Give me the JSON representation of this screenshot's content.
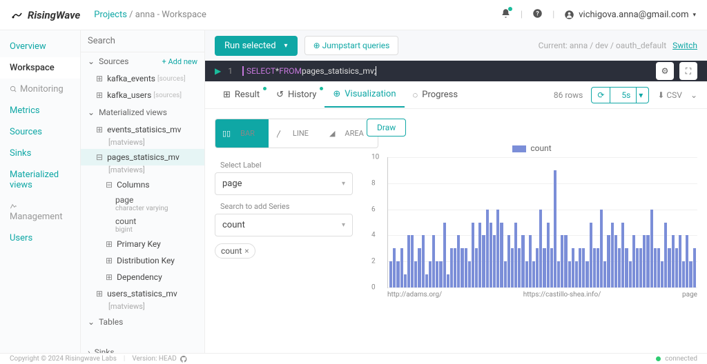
{
  "header": {
    "brand": "RisingWave",
    "breadcrumb_projects": "Projects",
    "breadcrumb_workspace": "anna - Workspace",
    "user_email": "vichigova.anna@gmail.com"
  },
  "nav1": {
    "overview": "Overview",
    "workspace": "Workspace",
    "monitoring": "Monitoring",
    "metrics": "Metrics",
    "sources": "Sources",
    "sinks": "Sinks",
    "mviews": "Materialized views",
    "management": "Management",
    "users": "Users"
  },
  "nav2": {
    "search_placeholder": "Search",
    "sources_hdr": "Sources",
    "add_new": "+ Add new",
    "kafka_events": "kafka_events",
    "sources_tag": "[sources]",
    "kafka_users": "kafka_users",
    "mviews_hdr": "Materialized views",
    "events_mv": "events_statisics_mv",
    "matviews_tag": "[matviews]",
    "pages_mv": "pages_statisics_mv",
    "columns": "Columns",
    "col_page": "page",
    "col_page_type": "character varying",
    "col_count": "count",
    "col_count_type": "bigint",
    "pk": "Primary Key",
    "dk": "Distribution Key",
    "dep": "Dependency",
    "users_mv": "users_statisics_mv",
    "tables_hdr": "Tables",
    "sinks_hdr": "Sinks"
  },
  "toolbar": {
    "run": "Run selected",
    "jump": "Jumpstart queries",
    "current_label": "Current:",
    "current_val": "anna / dev / oauth_default",
    "switch": "Switch"
  },
  "editor": {
    "line_no": "1",
    "kw1": "SELECT",
    "star": " * ",
    "kw2": "FROM",
    "table": " pages_statisics_mv;"
  },
  "tabs": {
    "result": "Result",
    "history": "History",
    "visualization": "Visualization",
    "progress": "Progress",
    "rows": "86 rows",
    "refresh_interval": "5s",
    "csv": "CSV"
  },
  "viz": {
    "type_bar": "BAR",
    "type_line": "LINE",
    "type_area": "AREA",
    "select_label": "Select Label",
    "label_val": "page",
    "series_label": "Search to add Series",
    "series_val": "count",
    "chip": "count",
    "draw": "Draw",
    "legend": "count",
    "xlabel1": "http://adams.org/",
    "xlabel2": "https://castillo-shea.info/",
    "xlabel3": "page"
  },
  "footer": {
    "copyright": "Copyright © 2024 Risingwave Labs",
    "version": "Version: HEAD",
    "connected": "connected"
  },
  "chart_data": {
    "type": "bar",
    "title": "",
    "xlabel": "page",
    "ylabel": "",
    "ylim": [
      0,
      10
    ],
    "yticks": [
      0,
      2,
      4,
      6,
      8,
      10
    ],
    "series": [
      {
        "name": "count",
        "values": [
          2,
          3,
          2,
          3,
          1,
          4,
          4,
          2,
          3,
          4,
          1,
          2,
          4,
          2,
          2,
          5,
          1,
          3,
          3,
          4,
          3,
          3,
          2,
          5,
          3,
          5,
          4,
          6,
          5,
          4,
          6,
          5,
          2,
          4,
          3,
          5,
          3,
          4,
          2,
          4,
          2,
          3,
          6,
          3,
          5,
          3,
          9,
          2,
          4,
          4,
          2,
          3,
          2,
          3,
          3,
          2,
          5,
          3,
          3,
          6,
          2,
          4,
          5,
          4,
          3,
          5,
          3,
          2,
          4,
          3,
          3,
          4,
          4,
          6,
          3,
          3,
          2,
          5,
          3,
          4,
          3,
          4,
          2,
          4,
          2,
          3
        ]
      }
    ],
    "x_sample_labels": [
      "http://adams.org/",
      "https://castillo-shea.info/"
    ]
  }
}
